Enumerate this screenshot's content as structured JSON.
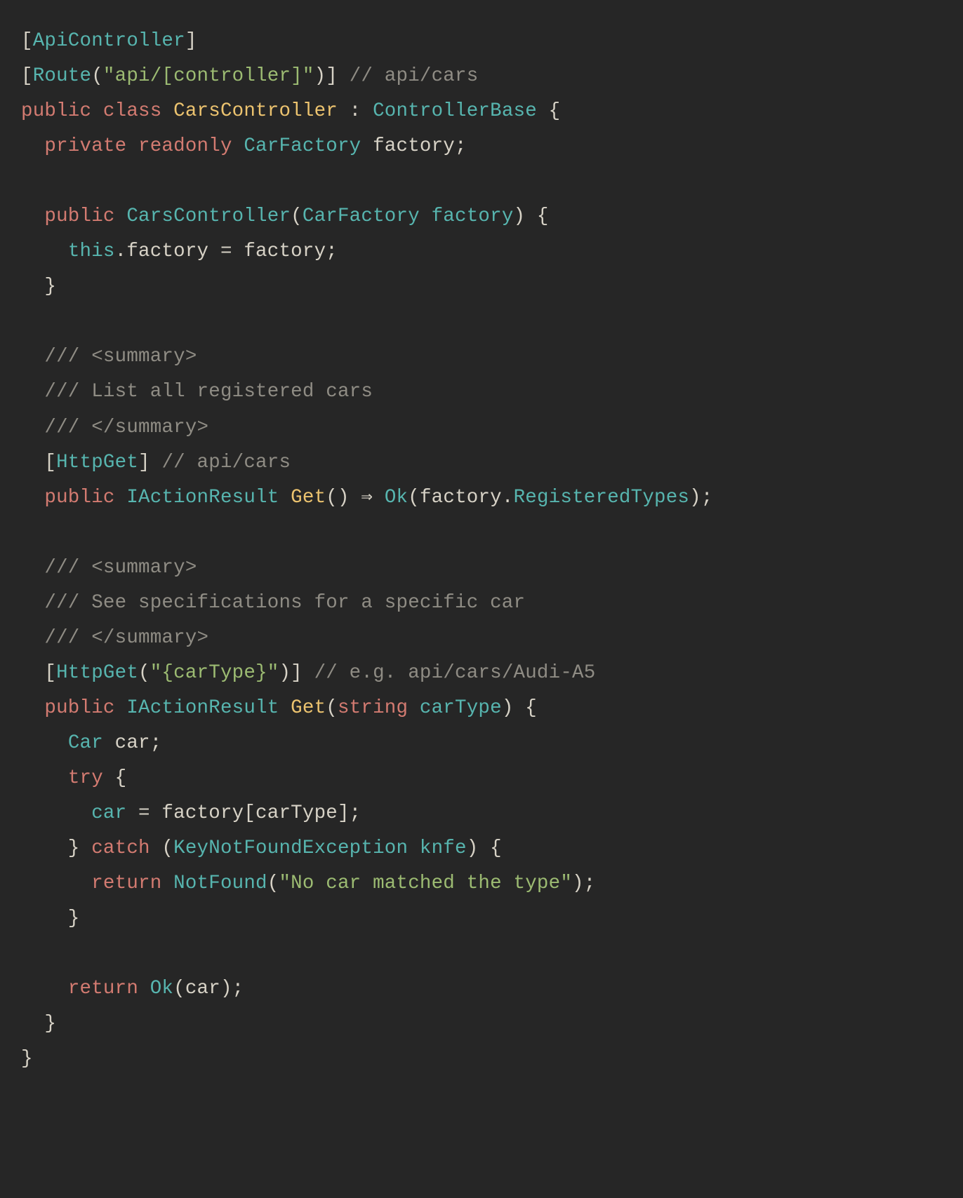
{
  "code": {
    "language": "csharp",
    "colors": {
      "background": "#262626",
      "default": "#d7d2c6",
      "keyword": "#d37b71",
      "type": "#57b5af",
      "function": "#ecc36f",
      "string": "#9cbb72",
      "comment": "#8f8c84"
    },
    "lines": [
      [
        [
          "plain",
          "["
        ],
        [
          "typ",
          "ApiController"
        ],
        [
          "plain",
          "]"
        ]
      ],
      [
        [
          "plain",
          "["
        ],
        [
          "typ",
          "Route"
        ],
        [
          "plain",
          "("
        ],
        [
          "str",
          "\"api/[controller]\""
        ],
        [
          "plain",
          ")] "
        ],
        [
          "cmt",
          "// api/cars"
        ]
      ],
      [
        [
          "kw",
          "public"
        ],
        [
          "plain",
          " "
        ],
        [
          "kw",
          "class"
        ],
        [
          "plain",
          " "
        ],
        [
          "fn",
          "CarsController"
        ],
        [
          "plain",
          " : "
        ],
        [
          "typ",
          "ControllerBase"
        ],
        [
          "plain",
          " {"
        ]
      ],
      [
        [
          "plain",
          "  "
        ],
        [
          "kw",
          "private"
        ],
        [
          "plain",
          " "
        ],
        [
          "kw",
          "readonly"
        ],
        [
          "plain",
          " "
        ],
        [
          "typ",
          "CarFactory"
        ],
        [
          "plain",
          " factory;"
        ]
      ],
      [
        [
          "plain",
          ""
        ]
      ],
      [
        [
          "plain",
          "  "
        ],
        [
          "kw",
          "public"
        ],
        [
          "plain",
          " "
        ],
        [
          "typ",
          "CarsController"
        ],
        [
          "plain",
          "("
        ],
        [
          "typ",
          "CarFactory"
        ],
        [
          "plain",
          " "
        ],
        [
          "typ",
          "factory"
        ],
        [
          "plain",
          ") {"
        ]
      ],
      [
        [
          "plain",
          "    "
        ],
        [
          "typ",
          "this"
        ],
        [
          "plain",
          ".factory = factory;"
        ]
      ],
      [
        [
          "plain",
          "  }"
        ]
      ],
      [
        [
          "plain",
          ""
        ]
      ],
      [
        [
          "plain",
          "  "
        ],
        [
          "cmt",
          "/// <summary>"
        ]
      ],
      [
        [
          "plain",
          "  "
        ],
        [
          "cmt",
          "/// List all registered cars"
        ]
      ],
      [
        [
          "plain",
          "  "
        ],
        [
          "cmt",
          "/// </summary>"
        ]
      ],
      [
        [
          "plain",
          "  ["
        ],
        [
          "typ",
          "HttpGet"
        ],
        [
          "plain",
          "] "
        ],
        [
          "cmt",
          "// api/cars"
        ]
      ],
      [
        [
          "plain",
          "  "
        ],
        [
          "kw",
          "public"
        ],
        [
          "plain",
          " "
        ],
        [
          "typ",
          "IActionResult"
        ],
        [
          "plain",
          " "
        ],
        [
          "fn",
          "Get"
        ],
        [
          "plain",
          "() ⇒ "
        ],
        [
          "typ",
          "Ok"
        ],
        [
          "plain",
          "(factory."
        ],
        [
          "typ",
          "RegisteredTypes"
        ],
        [
          "plain",
          ");"
        ]
      ],
      [
        [
          "plain",
          ""
        ]
      ],
      [
        [
          "plain",
          "  "
        ],
        [
          "cmt",
          "/// <summary>"
        ]
      ],
      [
        [
          "plain",
          "  "
        ],
        [
          "cmt",
          "/// See specifications for a specific car"
        ]
      ],
      [
        [
          "plain",
          "  "
        ],
        [
          "cmt",
          "/// </summary>"
        ]
      ],
      [
        [
          "plain",
          "  ["
        ],
        [
          "typ",
          "HttpGet"
        ],
        [
          "plain",
          "("
        ],
        [
          "str",
          "\"{carType}\""
        ],
        [
          "plain",
          ")] "
        ],
        [
          "cmt",
          "// e.g. api/cars/Audi-A5"
        ]
      ],
      [
        [
          "plain",
          "  "
        ],
        [
          "kw",
          "public"
        ],
        [
          "plain",
          " "
        ],
        [
          "typ",
          "IActionResult"
        ],
        [
          "plain",
          " "
        ],
        [
          "fn",
          "Get"
        ],
        [
          "plain",
          "("
        ],
        [
          "kw",
          "string"
        ],
        [
          "plain",
          " "
        ],
        [
          "typ",
          "carType"
        ],
        [
          "plain",
          ") {"
        ]
      ],
      [
        [
          "plain",
          "    "
        ],
        [
          "typ",
          "Car"
        ],
        [
          "plain",
          " car;"
        ]
      ],
      [
        [
          "plain",
          "    "
        ],
        [
          "kw",
          "try"
        ],
        [
          "plain",
          " {"
        ]
      ],
      [
        [
          "plain",
          "      "
        ],
        [
          "typ",
          "car"
        ],
        [
          "plain",
          " = factory[carType];"
        ]
      ],
      [
        [
          "plain",
          "    } "
        ],
        [
          "kw",
          "catch"
        ],
        [
          "plain",
          " ("
        ],
        [
          "typ",
          "KeyNotFoundException"
        ],
        [
          "plain",
          " "
        ],
        [
          "typ",
          "knfe"
        ],
        [
          "plain",
          ") {"
        ]
      ],
      [
        [
          "plain",
          "      "
        ],
        [
          "kw",
          "return"
        ],
        [
          "plain",
          " "
        ],
        [
          "typ",
          "NotFound"
        ],
        [
          "plain",
          "("
        ],
        [
          "str",
          "\"No car matched the type\""
        ],
        [
          "plain",
          ");"
        ]
      ],
      [
        [
          "plain",
          "    }"
        ]
      ],
      [
        [
          "plain",
          ""
        ]
      ],
      [
        [
          "plain",
          "    "
        ],
        [
          "kw",
          "return"
        ],
        [
          "plain",
          " "
        ],
        [
          "typ",
          "Ok"
        ],
        [
          "plain",
          "(car);"
        ]
      ],
      [
        [
          "plain",
          "  }"
        ]
      ],
      [
        [
          "plain",
          "}"
        ]
      ]
    ]
  }
}
